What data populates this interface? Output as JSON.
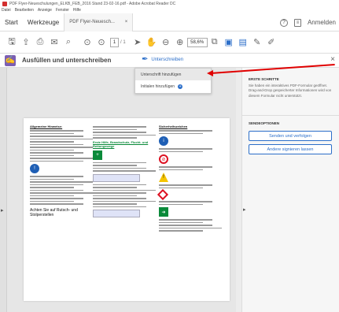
{
  "window": {
    "title": "PDF Flyer-Neueschulungen_ELKB_FEB_2016 Stand 23-02-16.pdf - Adobe Acrobat Reader DC"
  },
  "menu": [
    "Datei",
    "Bearbeiten",
    "Anzeige",
    "Fenster",
    "Hilfe"
  ],
  "tabs": {
    "start": "Start",
    "tools": "Werkzeuge",
    "doc": "PDF Flyer-Neuesch...",
    "doc_close": "×",
    "signin": "Anmelden"
  },
  "toolbar": {
    "page_current": "1",
    "page_total": "/ 1",
    "zoom": "58,6%"
  },
  "signbar": {
    "fill_label": "Ausfüllen und unterschreiben",
    "sign_label": "Unterschreiben",
    "close": "×"
  },
  "dropdown": {
    "item1": "Unterschrift hinzufügen",
    "item2": "Initialen hinzufügen"
  },
  "rightpanel": {
    "first_steps_title": "ERSTE SCHRITTE",
    "first_steps_text": "Sie haben ein interaktives PDF-Formular geöffnet. Drag-and-Drop gespeicherter Informationen wird von diesem Formular nicht unterstützt.",
    "send_title": "SENDEOPTIONEN",
    "send_button": "Senden und verfolgen",
    "others_button": "Andere signieren lassen"
  },
  "document": {
    "col1_heading": "Allgemeine Hinweise:",
    "col2_heading": "Erste Hilfe, Brandschutz, Flucht- und Rettungswege",
    "col3_heading": "Sicherheitszeichen",
    "col1_bottom": "Achten Sie auf Rutsch- und Stolperstellen"
  },
  "colors": {
    "accent": "#2b6ec9",
    "arrow": "#e00000",
    "fill_icon": "#7c5fb3"
  }
}
